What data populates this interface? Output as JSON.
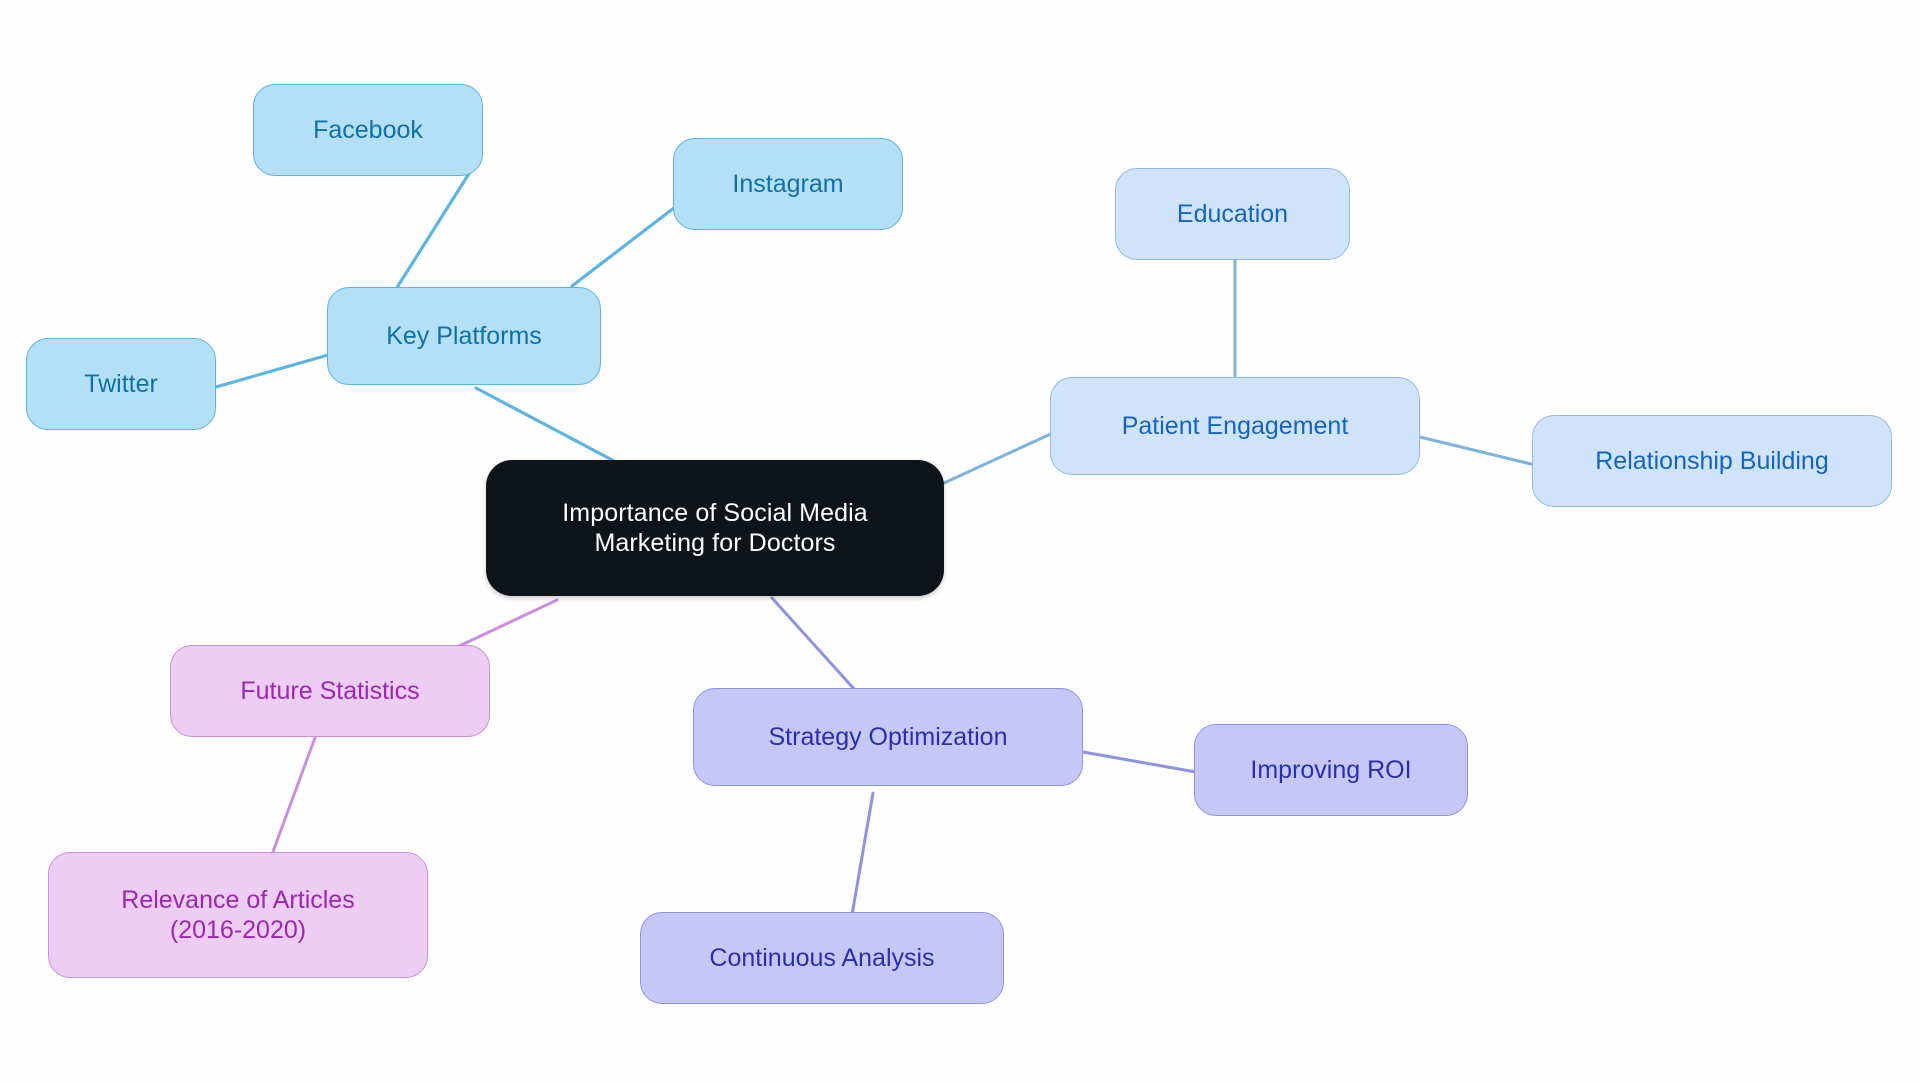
{
  "diagram": {
    "type": "mindmap",
    "title": "Importance of Social Media Marketing for Doctors",
    "background_color": "#fefeff",
    "root": {
      "id": "root",
      "label": "Importance of Social Media\nMarketing for Doctors",
      "fill": "#0f1419",
      "text_color": "#ffffff",
      "border": "#0f1419"
    },
    "palette": {
      "key_platforms_fill": "#b3e0f7",
      "key_platforms_border": "#5cb4e4",
      "key_platforms_text": "#1071a8",
      "patient_engagement_fill": "#cfe4fa",
      "patient_engagement_border": "#8cbbe8",
      "patient_engagement_text": "#1565c0",
      "strategy_fill": "#c5c8f7",
      "strategy_border": "#8e93e0",
      "strategy_text": "#2a2fae",
      "future_fill": "#eecdf5",
      "future_border": "#c98fdf",
      "future_text": "#9c27b0"
    },
    "branches": [
      {
        "id": "key-platforms",
        "label": "Key Platforms",
        "color_group": "key_platforms",
        "children": [
          {
            "id": "facebook",
            "label": "Facebook"
          },
          {
            "id": "instagram",
            "label": "Instagram"
          },
          {
            "id": "twitter",
            "label": "Twitter"
          }
        ]
      },
      {
        "id": "patient-engagement",
        "label": "Patient Engagement",
        "color_group": "patient_engagement",
        "children": [
          {
            "id": "education",
            "label": "Education"
          },
          {
            "id": "relationship-building",
            "label": "Relationship Building"
          }
        ]
      },
      {
        "id": "strategy-optimization",
        "label": "Strategy Optimization",
        "color_group": "strategy",
        "children": [
          {
            "id": "improving-roi",
            "label": "Improving ROI"
          },
          {
            "id": "continuous-analysis",
            "label": "Continuous Analysis"
          }
        ]
      },
      {
        "id": "future-statistics",
        "label": "Future Statistics",
        "color_group": "future",
        "children": [
          {
            "id": "relevance-of-articles",
            "label": "Relevance of Articles\n(2016-2020)"
          }
        ]
      }
    ],
    "nodes": {
      "root": {
        "label": "Importance of Social Media\nMarketing for Doctors"
      },
      "key_platforms": {
        "label": "Key Platforms"
      },
      "facebook": {
        "label": "Facebook"
      },
      "instagram": {
        "label": "Instagram"
      },
      "twitter": {
        "label": "Twitter"
      },
      "patient_engagement": {
        "label": "Patient Engagement"
      },
      "education": {
        "label": "Education"
      },
      "relationship_building": {
        "label": "Relationship Building"
      },
      "strategy_optimization": {
        "label": "Strategy Optimization"
      },
      "improving_roi": {
        "label": "Improving ROI"
      },
      "continuous_analysis": {
        "label": "Continuous Analysis"
      },
      "future_statistics": {
        "label": "Future Statistics"
      },
      "relevance_of_articles": {
        "label": "Relevance of Articles\n(2016-2020)"
      }
    },
    "edges": [
      {
        "from": "root",
        "to": "key_platforms",
        "color": "#5cb4e4"
      },
      {
        "from": "key_platforms",
        "to": "facebook",
        "color": "#5cb4e4"
      },
      {
        "from": "key_platforms",
        "to": "instagram",
        "color": "#5cb4e4"
      },
      {
        "from": "key_platforms",
        "to": "twitter",
        "color": "#5cb4e4"
      },
      {
        "from": "root",
        "to": "patient_engagement",
        "color": "#7fb2dd"
      },
      {
        "from": "patient_engagement",
        "to": "education",
        "color": "#7fb2dd"
      },
      {
        "from": "patient_engagement",
        "to": "relationship_building",
        "color": "#7fb2dd"
      },
      {
        "from": "root",
        "to": "strategy_optimization",
        "color": "#8e93e0"
      },
      {
        "from": "strategy_optimization",
        "to": "improving_roi",
        "color": "#8e93e0"
      },
      {
        "from": "strategy_optimization",
        "to": "continuous_analysis",
        "color": "#8e93e0"
      },
      {
        "from": "root",
        "to": "future_statistics",
        "color": "#c98fdf"
      },
      {
        "from": "future_statistics",
        "to": "relevance_of_articles",
        "color": "#c98fdf"
      }
    ]
  }
}
